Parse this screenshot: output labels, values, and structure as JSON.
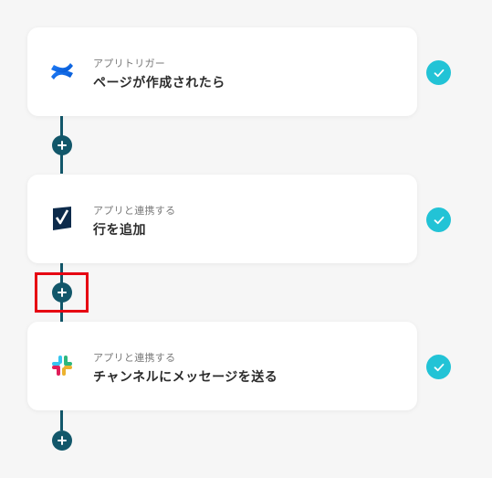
{
  "steps": [
    {
      "type_label": "アプリトリガー",
      "title": "ページが作成されたら",
      "app_icon": "confluence-icon",
      "status": "completed"
    },
    {
      "type_label": "アプリと連携する",
      "title": "行を追加",
      "app_icon": "smartsheet-icon",
      "status": "completed"
    },
    {
      "type_label": "アプリと連携する",
      "title": "チャンネルにメッセージを送る",
      "app_icon": "slack-icon",
      "status": "completed"
    }
  ],
  "add_buttons": [
    "add-step-button",
    "add-step-button",
    "add-step-button"
  ],
  "colors": {
    "background": "#f6f6f6",
    "connector": "#12576a",
    "check": "#22c3d6",
    "highlight": "#e60012"
  }
}
